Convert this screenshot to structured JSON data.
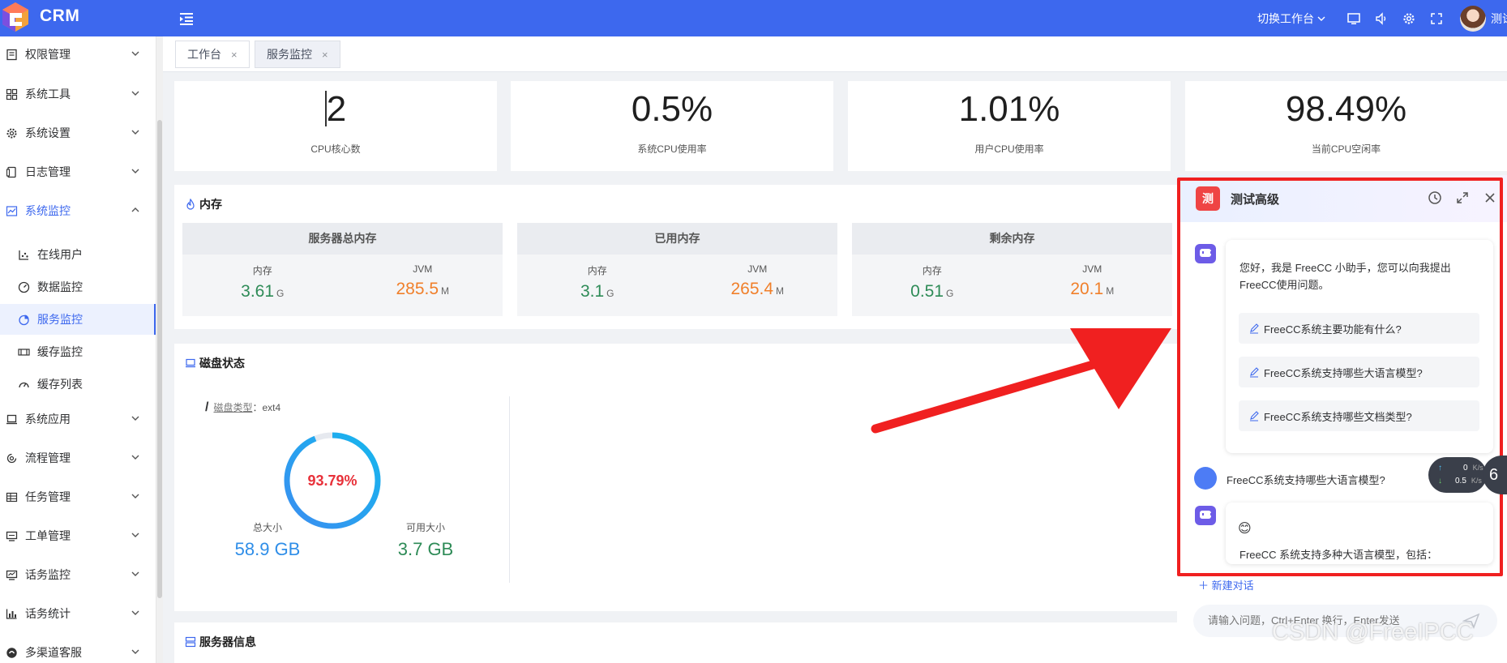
{
  "header": {
    "brand": "CRM",
    "switch_workbench": "切换工作台",
    "user_name": "测试"
  },
  "sidebar": {
    "items": [
      {
        "label": "权限管理",
        "icon": "permission-icon"
      },
      {
        "label": "系统工具",
        "icon": "grid-icon"
      },
      {
        "label": "系统设置",
        "icon": "gear-icon"
      },
      {
        "label": "日志管理",
        "icon": "log-icon"
      },
      {
        "label": "系统监控",
        "icon": "monitor-chart-icon"
      },
      {
        "label": "系统应用",
        "icon": "laptop-icon"
      },
      {
        "label": "流程管理",
        "icon": "flow-icon"
      },
      {
        "label": "任务管理",
        "icon": "table-icon"
      },
      {
        "label": "工单管理",
        "icon": "ticket-icon"
      },
      {
        "label": "话务监控",
        "icon": "call-monitor-icon"
      },
      {
        "label": "话务统计",
        "icon": "bar-chart-icon"
      },
      {
        "label": "多渠道客服",
        "icon": "channel-icon"
      }
    ],
    "monitor_children": [
      {
        "label": "在线用户",
        "icon": "scatter-icon"
      },
      {
        "label": "数据监控",
        "icon": "dashboard-icon"
      },
      {
        "label": "服务监控",
        "icon": "pie-icon"
      },
      {
        "label": "缓存监控",
        "icon": "cache-icon"
      },
      {
        "label": "缓存列表",
        "icon": "gauge-icon"
      }
    ]
  },
  "tabs": [
    {
      "label": "工作台",
      "close": "×"
    },
    {
      "label": "服务监控",
      "close": "×"
    }
  ],
  "cpu": [
    {
      "value": "2",
      "label": "CPU核心数"
    },
    {
      "value": "0.5%",
      "label": "系统CPU使用率"
    },
    {
      "value": "1.01%",
      "label": "用户CPU使用率"
    },
    {
      "value": "98.49%",
      "label": "当前CPU空闲率"
    }
  ],
  "memory": {
    "title": "内存",
    "blocks": [
      {
        "title": "服务器总内存",
        "mem_label": "内存",
        "mem_value": "3.61",
        "mem_unit": "G",
        "jvm_label": "JVM",
        "jvm_value": "285.5",
        "jvm_unit": "M"
      },
      {
        "title": "已用内存",
        "mem_label": "内存",
        "mem_value": "3.1",
        "mem_unit": "G",
        "jvm_label": "JVM",
        "jvm_value": "265.4",
        "jvm_unit": "M"
      },
      {
        "title": "剩余内存",
        "mem_label": "内存",
        "mem_value": "0.51",
        "mem_unit": "G",
        "jvm_label": "JVM",
        "jvm_value": "20.1",
        "jvm_unit": "M"
      }
    ]
  },
  "disk": {
    "title": "磁盘状态",
    "path": "/",
    "type_label": "磁盘类型",
    "type_value": "：ext4",
    "usage": "93.79%",
    "usage_fraction": 0.9379,
    "total_label": "总大小",
    "total_value": "58.9 GB",
    "free_label": "可用大小",
    "free_value": "3.7 GB"
  },
  "server_info": {
    "title": "服务器信息"
  },
  "chat": {
    "badge": "测",
    "title": "测试高级",
    "greeting": "您好，我是 FreeCC 小助手，您可以向我提出 FreeCC使用问题。",
    "suggestions": [
      "FreeCC系统主要功能有什么?",
      "FreeCC系统支持哪些大语言模型?",
      "FreeCC系统支持哪些文档类型?"
    ],
    "user_message": "FreeCC系统支持哪些大语言模型?",
    "answer_emoji": "😊",
    "answer_text": "FreeCC 系统支持多种大语言模型，包括：",
    "new_chat": "新建对话",
    "input_placeholder": "请输入问题，Ctrl+Enter 换行，Enter发送"
  },
  "net_speed": {
    "up": "0",
    "up_unit": "K/s",
    "down": "0.5",
    "down_unit": "K/s"
  },
  "side_badge": "6",
  "watermark": "CSDN @FreeIPCC",
  "colors": {
    "primary": "#3d68ee",
    "annotation_red": "#f02020",
    "green": "#2e8b57",
    "orange": "#f07f2a",
    "disk_red": "#e8313a",
    "disk_blue": "#2f8ee8"
  }
}
